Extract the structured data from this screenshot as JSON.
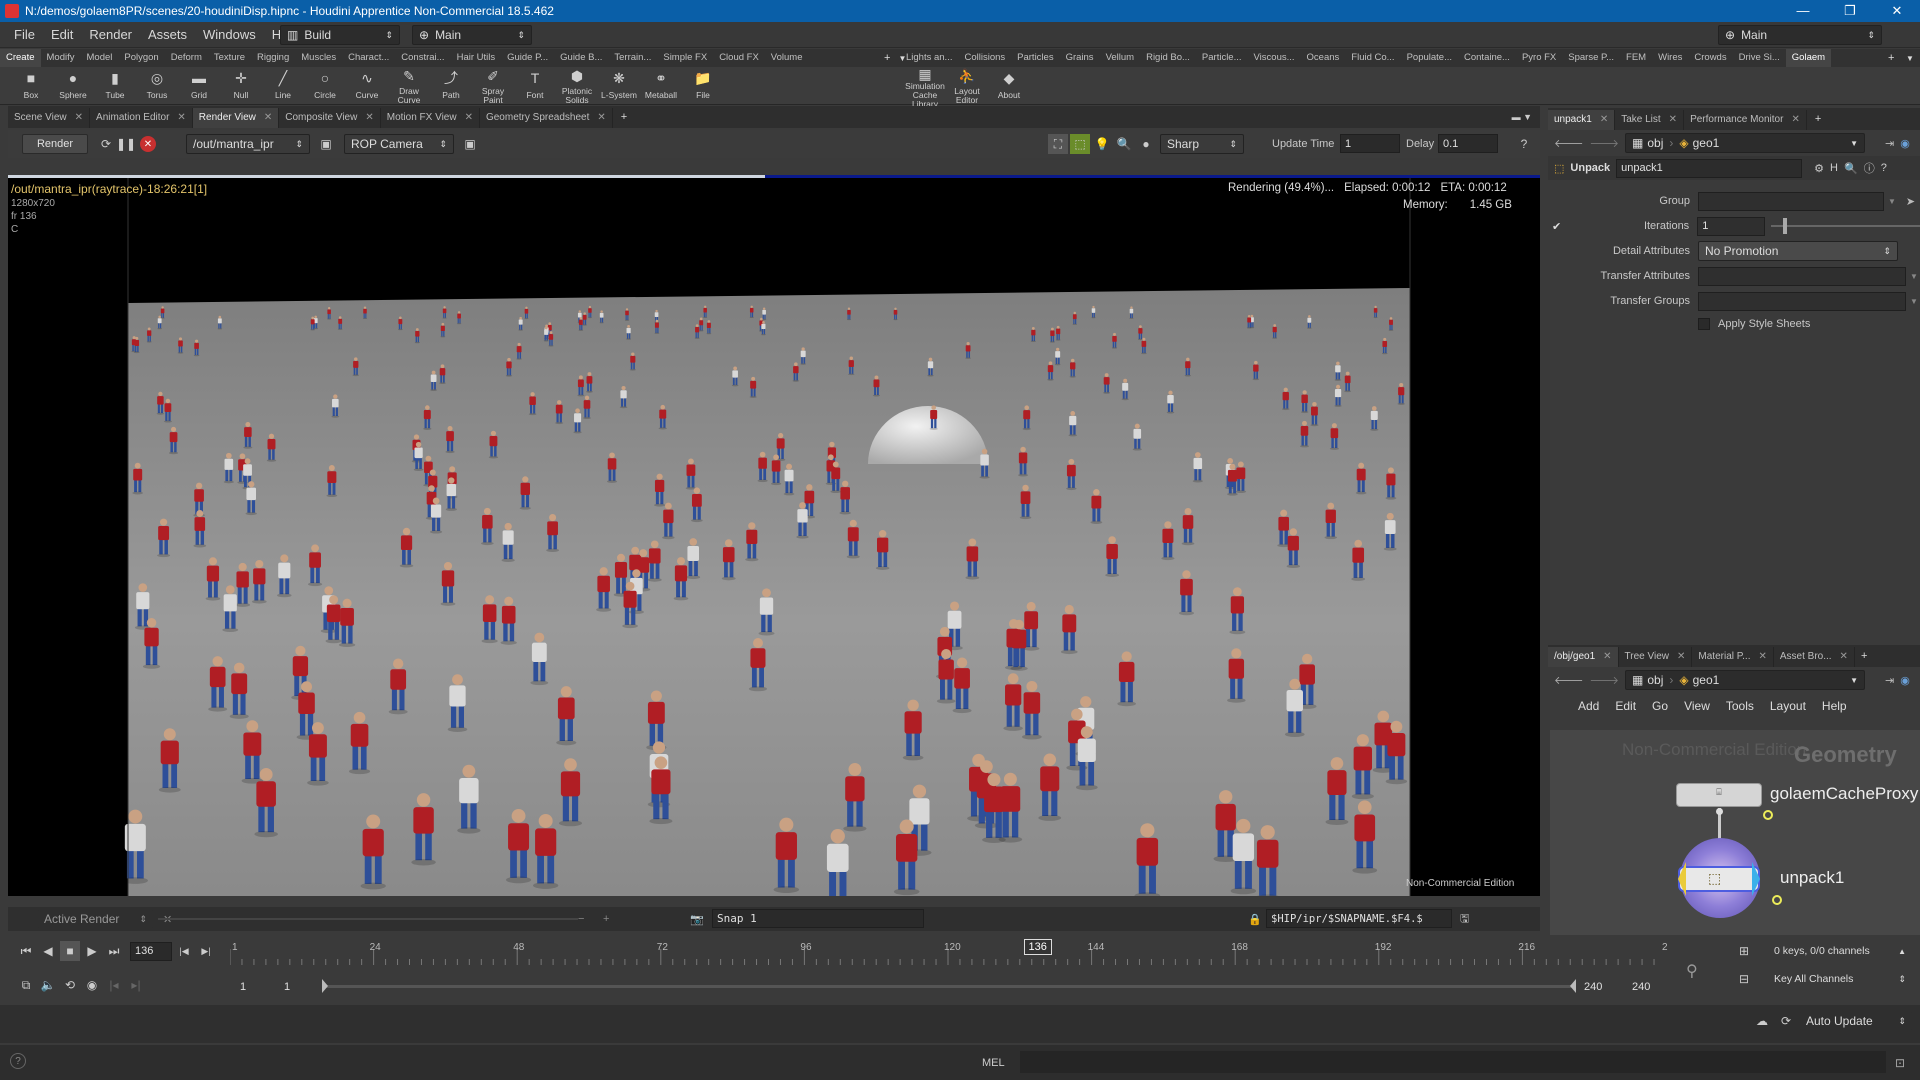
{
  "window": {
    "title": "N:/demos/golaem8PR/scenes/20-houdiniDisp.hipnc - Houdini Apprentice Non-Commercial 18.5.462",
    "minimize": "—",
    "maximize": "❐",
    "close": "✕"
  },
  "menubar": {
    "items": [
      "File",
      "Edit",
      "Render",
      "Assets",
      "Windows",
      "Help"
    ],
    "build_label": "Build",
    "desktop_label": "Main",
    "right_desktop_label": "Main"
  },
  "shelf_tabs_left": [
    "Create",
    "Modify",
    "Model",
    "Polygon",
    "Deform",
    "Texture",
    "Rigging",
    "Muscles",
    "Charact...",
    "Constrai...",
    "Hair Utils",
    "Guide P...",
    "Guide B...",
    "Terrain...",
    "Simple FX",
    "Cloud FX",
    "Volume"
  ],
  "shelf_tabs_right": [
    "Lights an...",
    "Collisions",
    "Particles",
    "Grains",
    "Vellum",
    "Rigid Bo...",
    "Particle...",
    "Viscous...",
    "Oceans",
    "Fluid Co...",
    "Populate...",
    "Containe...",
    "Pyro FX",
    "Sparse P...",
    "FEM",
    "Wires",
    "Crowds",
    "Drive Si...",
    "Golaem"
  ],
  "shelf_tools_left": [
    {
      "label": "Box",
      "icon": "box-icon",
      "glyph": "■"
    },
    {
      "label": "Sphere",
      "icon": "sphere-icon",
      "glyph": "●"
    },
    {
      "label": "Tube",
      "icon": "tube-icon",
      "glyph": "▮"
    },
    {
      "label": "Torus",
      "icon": "torus-icon",
      "glyph": "◎"
    },
    {
      "label": "Grid",
      "icon": "grid-icon",
      "glyph": "▬"
    },
    {
      "label": "Null",
      "icon": "null-icon",
      "glyph": "✛"
    },
    {
      "label": "Line",
      "icon": "line-icon",
      "glyph": "╱"
    },
    {
      "label": "Circle",
      "icon": "circle-icon",
      "glyph": "○"
    },
    {
      "label": "Curve",
      "icon": "curve-icon",
      "glyph": "∿"
    },
    {
      "label": "Draw Curve",
      "icon": "draw-curve-icon",
      "glyph": "✎"
    },
    {
      "label": "Path",
      "icon": "path-icon",
      "glyph": "⤴"
    },
    {
      "label": "Spray Paint",
      "icon": "spray-paint-icon",
      "glyph": "✐"
    },
    {
      "label": "Font",
      "icon": "font-icon",
      "glyph": "T"
    },
    {
      "label": "Platonic Solids",
      "icon": "platonic-icon",
      "glyph": "⬢"
    },
    {
      "label": "L-System",
      "icon": "lsystem-icon",
      "glyph": "❋"
    },
    {
      "label": "Metaball",
      "icon": "metaball-icon",
      "glyph": "⚭"
    },
    {
      "label": "File",
      "icon": "file-icon",
      "glyph": "📁"
    }
  ],
  "shelf_tools_right": [
    {
      "label": "Simulation Cache Library",
      "icon": "cache-library-icon",
      "glyph": "▦"
    },
    {
      "label": "Layout Editor",
      "icon": "layout-editor-icon",
      "glyph": "⛹"
    },
    {
      "label": "About",
      "icon": "about-icon",
      "glyph": "◆"
    }
  ],
  "left_pane_tabs": [
    "Scene View",
    "Animation Editor",
    "Render View",
    "Composite View",
    "Motion FX View",
    "Geometry Spreadsheet"
  ],
  "render_toolbar": {
    "render_label": "Render",
    "rop_path": "/out/mantra_ipr",
    "camera": "ROP Camera",
    "preview_mode": "Sharp",
    "update_time_label": "Update Time",
    "update_time_value": "1",
    "delay_label": "Delay",
    "delay_value": "0.1"
  },
  "viewport": {
    "image_name": "/out/mantra_ipr(raytrace)-18:26:21[1]",
    "resolution": "1280x720",
    "frame": "fr 136",
    "channel": "C",
    "status": "Rendering (49.4%)...",
    "elapsed": "Elapsed: 0:00:12",
    "eta": "ETA: 0:00:12",
    "memory_label": "Memory:",
    "memory_value": "1.45 GB",
    "watermark": "Non-Commercial Edition",
    "progress": 0.494
  },
  "viewer_status": {
    "active_render": "Active Render",
    "snap_label": "Snap 1",
    "snap_path": "$HIP/ipr/$SNAPNAME.$F4.$"
  },
  "right_top_tabs": [
    "unpack1",
    "Take List",
    "Performance Monitor"
  ],
  "param_pane": {
    "nav_path": "obj",
    "nav_node": "geo1",
    "node_type": "Unpack",
    "node_name": "unpack1",
    "params": {
      "group_label": "Group",
      "iterations_label": "Iterations",
      "iterations_value": "1",
      "detail_label": "Detail Attributes",
      "detail_value": "No Promotion",
      "transfer_attr_label": "Transfer Attributes",
      "transfer_groups_label": "Transfer Groups",
      "style_sheets_label": "Apply Style Sheets"
    }
  },
  "right_bottom_tabs": [
    "/obj/geo1",
    "Tree View",
    "Material P...",
    "Asset Bro..."
  ],
  "network": {
    "nav_path": "obj",
    "nav_node": "geo1",
    "menu": [
      "Add",
      "Edit",
      "Go",
      "View",
      "Tools",
      "Layout",
      "Help"
    ],
    "watermark": "Non-Commercial Edition",
    "context_label": "Geometry",
    "nodes": [
      {
        "name": "golaemCacheProxy",
        "type": "proxy"
      },
      {
        "name": "unpack1",
        "type": "unpack"
      }
    ]
  },
  "timeline": {
    "current_frame": "136",
    "frame_marker": "136",
    "ticks": [
      "1",
      "24",
      "48",
      "72",
      "96",
      "120",
      "144",
      "168",
      "192",
      "216",
      "2"
    ],
    "range_start": "1",
    "range_start2": "1",
    "range_end": "240",
    "range_end2": "240",
    "keys_info": "0 keys, 0/0 channels",
    "key_all": "Key All Channels",
    "auto_update": "Auto Update"
  },
  "statusbar": {
    "shell": "MEL"
  },
  "colors": {
    "titlebar": "#0a5fa8",
    "progress_done": "#cfd6e0",
    "progress_rest": "#0a1a8c",
    "shirt_red": "#b01e24",
    "pants_blue": "#2e4f99",
    "floor": "#8f8f8f"
  }
}
